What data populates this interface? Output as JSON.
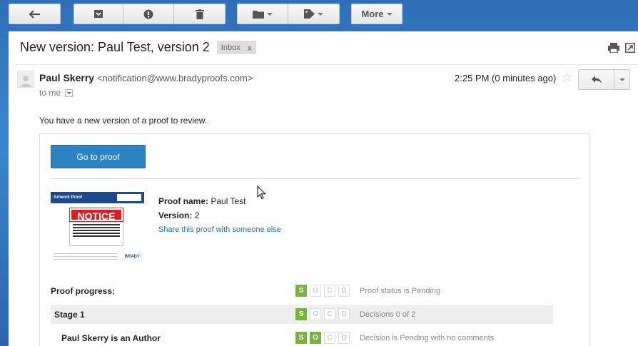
{
  "toolbar": {
    "back_icon": "arrow-left-icon",
    "archive_icon": "archive-icon",
    "spam_icon": "report-spam-icon",
    "delete_icon": "trash-icon",
    "move_icon": "folder-icon",
    "labels_icon": "tag-icon",
    "more_label": "More"
  },
  "message": {
    "subject": "New version: Paul Test, version 2",
    "label": "Inbox",
    "label_remove": "x",
    "sender_name": "Paul Skerry",
    "sender_email": "<notification@www.bradyproofs.com>",
    "recipient": "to me",
    "time": "2:25 PM (0 minutes ago)",
    "intro": "You have a new version of a proof to review."
  },
  "proof": {
    "button_label": "Go to proof",
    "name_label": "Proof name:",
    "name_value": "Paul Test",
    "version_label": "Version:",
    "version_value": "2",
    "share_link": "Share this proof with someone else",
    "thumbnail": {
      "header_title": "Artwork Proof",
      "notice": "NOTICE"
    },
    "progress_rows": [
      {
        "label": "Proof progress:",
        "status": "Proof status is Pending",
        "active": [
          "S"
        ]
      },
      {
        "label": "Stage 1",
        "status": "Decisions 0 of 2",
        "active": [
          "S"
        ]
      },
      {
        "label": "Paul Skerry is an Author",
        "status": "Decision is Pending with no comments",
        "active": [
          "S",
          "O"
        ]
      }
    ],
    "step_letters": [
      "S",
      "O",
      "C",
      "D"
    ]
  },
  "colors": {
    "accent": "#2b83c4",
    "active_step": "#7bb23a",
    "notice_red": "#d81f26"
  }
}
